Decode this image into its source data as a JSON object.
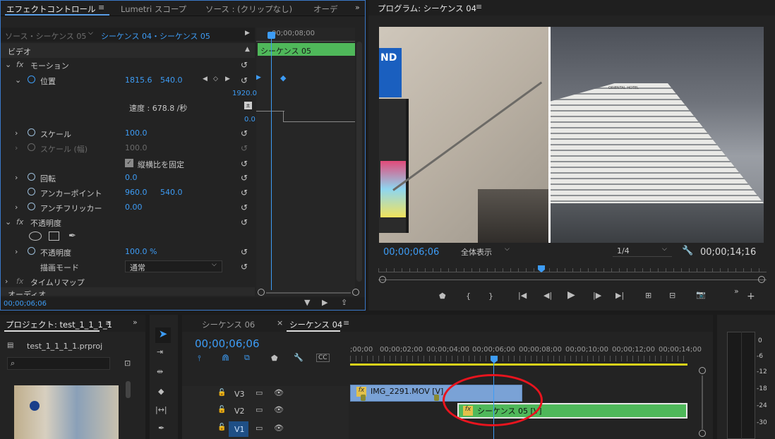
{
  "effects": {
    "tabs": [
      "エフェクトコントロール",
      "Lumetri スコープ",
      "ソース : (クリップなし)",
      "オーデ"
    ],
    "source_label": "ソース・シーケンス 05",
    "sequence_label": "シーケンス 04・シーケンス 05",
    "ruler_time": "00;00;08;00",
    "clip_label": "シーケンス 05",
    "video_header": "ビデオ",
    "audio_header": "オーディオ",
    "motion": "モーション",
    "position": {
      "label": "位置",
      "x": "1815.6",
      "y": "540.0"
    },
    "graph_top": "1920.0",
    "graph_bottom": "0.0",
    "speed": "速度 : 678.8 /秒",
    "scale": {
      "label": "スケール",
      "value": "100.0"
    },
    "scale_width": {
      "label": "スケール (幅)",
      "value": "100.0"
    },
    "uniform": "縦横比を固定",
    "rotation": {
      "label": "回転",
      "value": "0.0"
    },
    "anchor": {
      "label": "アンカーポイント",
      "x": "960.0",
      "y": "540.0"
    },
    "antiflicker": {
      "label": "アンチフリッカー",
      "value": "0.00"
    },
    "opacity_group": "不透明度",
    "opacity": {
      "label": "不透明度",
      "value": "100.0 %"
    },
    "blend": {
      "label": "描画モード",
      "value": "通常"
    },
    "time_remap": "タイムリマップ",
    "timecode": "00;00;06;06"
  },
  "program": {
    "title": "プログラム: シーケンス 04",
    "timecode": "00;00;06;06",
    "fit": "全体表示",
    "quality": "1/4",
    "duration": "00;00;14;16",
    "image_text": {
      "left_sign": "ND",
      "hotel_sign": "ORIENTAL HOTEL"
    }
  },
  "project": {
    "title": "プロジェクト: test_1_1_1_1",
    "file": "test_1_1_1_1.prproj"
  },
  "timeline": {
    "tabs": [
      "シーケンス 06",
      "シーケンス 04"
    ],
    "timecode": "00;00;06;06",
    "ruler": [
      ";00;00",
      "00;00;02;00",
      "00;00;04;00",
      "00;00;06;00",
      "00;00;08;00",
      "00;00;10;00",
      "00;00;12;00",
      "00;00;14;00"
    ],
    "tracks": [
      "V3",
      "V2",
      "V1"
    ],
    "clip_v3": "IMG_2291.MOV [V]",
    "clip_v2": "シーケンス 05 [V]",
    "fx_badge": "fx"
  },
  "meter": {
    "scale": [
      "0",
      "-6",
      "-12",
      "-18",
      "-24",
      "-30"
    ]
  },
  "colors": {
    "accent": "#3d9cf5",
    "clip_blue": "#7aa2d6",
    "clip_green": "#4fb85a",
    "highlight": "#e8141e"
  }
}
